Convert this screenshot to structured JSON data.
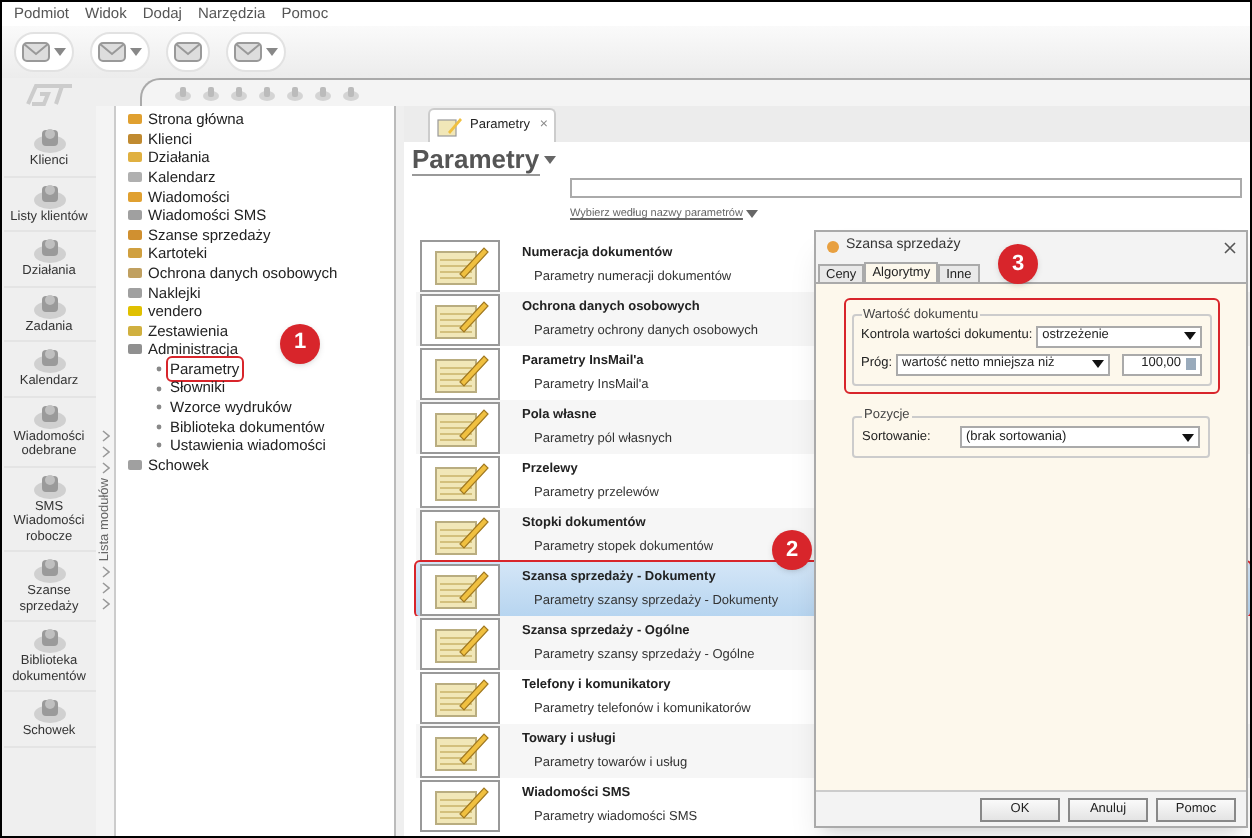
{
  "menu": [
    "Podmiot",
    "Widok",
    "Dodaj",
    "Narzędzia",
    "Pomoc"
  ],
  "toolbar": [
    {
      "kind": "split"
    },
    {
      "kind": "split"
    },
    {
      "kind": "plain"
    },
    {
      "kind": "split"
    }
  ],
  "sidebar": {
    "items": [
      {
        "label": "Klienci"
      },
      {
        "label": "Listy klientów"
      },
      {
        "label": "Działania"
      },
      {
        "label": "Zadania"
      },
      {
        "label": "Kalendarz"
      },
      {
        "label": "Wiadomości odebrane"
      },
      {
        "label": "SMS Wiadomości robocze"
      },
      {
        "label": "Szanse sprzedaży"
      },
      {
        "label": "Biblioteka dokumentów"
      },
      {
        "label": "Schowek"
      }
    ]
  },
  "module_strip": {
    "label": "Lista modułów"
  },
  "tree": {
    "items": [
      {
        "label": "Strona główna",
        "color": "#e0a030"
      },
      {
        "label": "Klienci",
        "color": "#c08a30"
      },
      {
        "label": "Działania",
        "color": "#e0b040"
      },
      {
        "label": "Kalendarz",
        "color": "#b0b0b0"
      },
      {
        "label": "Wiadomości",
        "color": "#e0a030"
      },
      {
        "label": "Wiadomości SMS",
        "color": "#a0a0a0"
      },
      {
        "label": "Szanse sprzedaży",
        "color": "#d09030"
      },
      {
        "label": "Kartoteki",
        "color": "#d0a040"
      },
      {
        "label": "Ochrona danych osobowych",
        "color": "#c0a060"
      },
      {
        "label": "Naklejki",
        "color": "#a0a0a0"
      },
      {
        "label": "vendero",
        "color": "#e0c000"
      },
      {
        "label": "Zestawienia",
        "color": "#d0b040"
      },
      {
        "label": "Administracja",
        "color": "#909090",
        "children": [
          {
            "label": "Parametry",
            "outlined": true,
            "callout": "1"
          },
          {
            "label": "Słowniki",
            "outlined": false
          },
          {
            "label": "Wzorce wydruków",
            "outlined": false
          },
          {
            "label": "Biblioteka dokumentów",
            "outlined": false
          },
          {
            "label": "Ustawienia wiadomości",
            "outlined": false
          }
        ]
      },
      {
        "label": "Schowek",
        "color": "#a0a0a0"
      }
    ]
  },
  "tab": {
    "label": "Parametry",
    "close": "×"
  },
  "page": {
    "title": "Parametry",
    "filter_link": "Wybierz według nazwy parametrów"
  },
  "parameters": [
    {
      "title": "Numeracja dokumentów",
      "description": "Parametry numeracji dokumentów",
      "selected": false
    },
    {
      "title": "Ochrona danych osobowych",
      "description": "Parametry ochrony danych osobowych",
      "selected": false
    },
    {
      "title": "Parametry InsMail'a",
      "description": "Parametry InsMail'a",
      "selected": false
    },
    {
      "title": "Pola własne",
      "description": "Parametry pól własnych",
      "selected": false
    },
    {
      "title": "Przelewy",
      "description": "Parametry przelewów",
      "selected": false
    },
    {
      "title": "Stopki dokumentów",
      "description": "Parametry stopek dokumentów",
      "selected": false
    },
    {
      "title": "Szansa sprzedaży - Dokumenty",
      "description": "Parametry szansy sprzedaży - Dokumenty",
      "selected": true,
      "callout": "2"
    },
    {
      "title": "Szansa sprzedaży - Ogólne",
      "description": "Parametry szansy sprzedaży - Ogólne",
      "selected": false
    },
    {
      "title": "Telefony i komunikatory",
      "description": "Parametry telefonów i komunikatorów",
      "selected": false
    },
    {
      "title": "Towary i usługi",
      "description": "Parametry towarów i usług",
      "selected": false
    },
    {
      "title": "Wiadomości SMS",
      "description": "Parametry wiadomości SMS",
      "selected": false
    }
  ],
  "dialog": {
    "title": "Szansa sprzedaży",
    "tabs": [
      {
        "label": "Ceny",
        "selected": false
      },
      {
        "label": "Algorytmy",
        "selected": true
      },
      {
        "label": "Inne",
        "selected": false
      }
    ],
    "callout": "3",
    "groups": [
      {
        "title": "Wartość dokumentu",
        "outlined": true,
        "rows": [
          {
            "label": "Kontrola wartości dokumentu:",
            "select": "ostrzeżenie"
          },
          {
            "label": "Próg:",
            "select": "wartość netto mniejsza niż",
            "amount": "100,00"
          }
        ]
      },
      {
        "title": "Pozycje",
        "outlined": false,
        "rows": [
          {
            "label": "Sortowanie:",
            "select": "(brak sortowania)"
          }
        ]
      }
    ],
    "buttons": [
      "OK",
      "Anuluj",
      "Pomoc"
    ]
  }
}
